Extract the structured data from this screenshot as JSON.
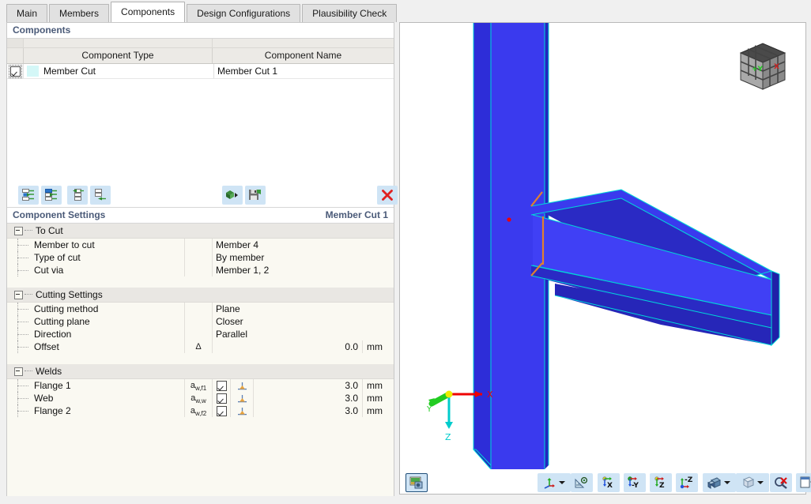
{
  "tabs": [
    {
      "label": "Main",
      "active": false
    },
    {
      "label": "Members",
      "active": false
    },
    {
      "label": "Components",
      "active": true
    },
    {
      "label": "Design Configurations",
      "active": false
    },
    {
      "label": "Plausibility Check",
      "active": false
    }
  ],
  "components_panel": {
    "title": "Components",
    "columns": [
      "Component Type",
      "Component Name"
    ],
    "rows": [
      {
        "checked": true,
        "swatch_color": "#d4f7f7",
        "type": "Member Cut",
        "name": "Member Cut 1"
      }
    ],
    "toolbar": {
      "left_buttons": [
        "new-component-icon",
        "duplicate-component-icon",
        "move-up-icon",
        "move-down-icon"
      ],
      "mid_buttons": [
        "import-component-icon",
        "save-component-icon"
      ],
      "right_buttons": [
        "delete-component-icon"
      ]
    }
  },
  "component_settings": {
    "title": "Component Settings",
    "subject": "Member Cut 1",
    "sections": [
      {
        "name": "To Cut",
        "expanded": true,
        "rows": [
          {
            "label": "Member to cut",
            "symbol": "",
            "value": "Member 4",
            "unit": "",
            "numeric": false
          },
          {
            "label": "Type of cut",
            "symbol": "",
            "value": "By member",
            "unit": "",
            "numeric": false
          },
          {
            "label": "Cut via",
            "symbol": "",
            "value": "Member 1, 2",
            "unit": "",
            "numeric": false
          }
        ]
      },
      {
        "name": "Cutting Settings",
        "expanded": true,
        "rows": [
          {
            "label": "Cutting method",
            "symbol": "",
            "value": "Plane",
            "unit": "",
            "numeric": false
          },
          {
            "label": "Cutting plane",
            "symbol": "",
            "value": "Closer",
            "unit": "",
            "numeric": false
          },
          {
            "label": "Direction",
            "symbol": "",
            "value": "Parallel",
            "unit": "",
            "numeric": false
          },
          {
            "label": "Offset",
            "symbol": "Δ",
            "value": "0.0",
            "unit": "mm",
            "numeric": true
          }
        ]
      },
      {
        "name": "Welds",
        "expanded": true,
        "rows": [
          {
            "label": "Flange 1",
            "symbol_base": "a",
            "symbol_sub": "w,f1",
            "checked": true,
            "weld_icon": true,
            "value": "3.0",
            "unit": "mm",
            "numeric": true
          },
          {
            "label": "Web",
            "symbol_base": "a",
            "symbol_sub": "w,w",
            "checked": true,
            "weld_icon": true,
            "value": "3.0",
            "unit": "mm",
            "numeric": true
          },
          {
            "label": "Flange 2",
            "symbol_base": "a",
            "symbol_sub": "w,f2",
            "checked": true,
            "weld_icon": true,
            "value": "3.0",
            "unit": "mm",
            "numeric": true
          }
        ]
      }
    ]
  },
  "viewport": {
    "model_description": "Steel beam to column welded connection, 3D isometric view",
    "member_color": "#3333ee",
    "edge_color": "#00d8d8",
    "weld_color": "#e08030",
    "node_color": "#ee0000",
    "nav_cube": {
      "front_label": "+Y",
      "right_label": "X",
      "front_label_color": "#22cc22",
      "right_label_color": "#cc2222"
    },
    "axis_triad": {
      "x_label": "X",
      "y_label": "Y",
      "z_label": "Z",
      "x_color": "#ee0000",
      "y_color": "#22cc22",
      "z_color": "#00cccc"
    },
    "toolbar": {
      "capture_button": "image-capture-icon",
      "buttons": [
        "axis-display-icon",
        "measure-icon",
        "view-x-icon",
        "view-minus-y-icon",
        "view-z-icon",
        "view-minus-z-icon",
        "render-mode-icon",
        "wireframe-icon",
        "zoom-reset-icon",
        "panel-toggle-icon"
      ],
      "view_labels": {
        "x": "X",
        "minus_y": "-Y",
        "z": "Z",
        "minus_z": "-Z"
      }
    }
  }
}
